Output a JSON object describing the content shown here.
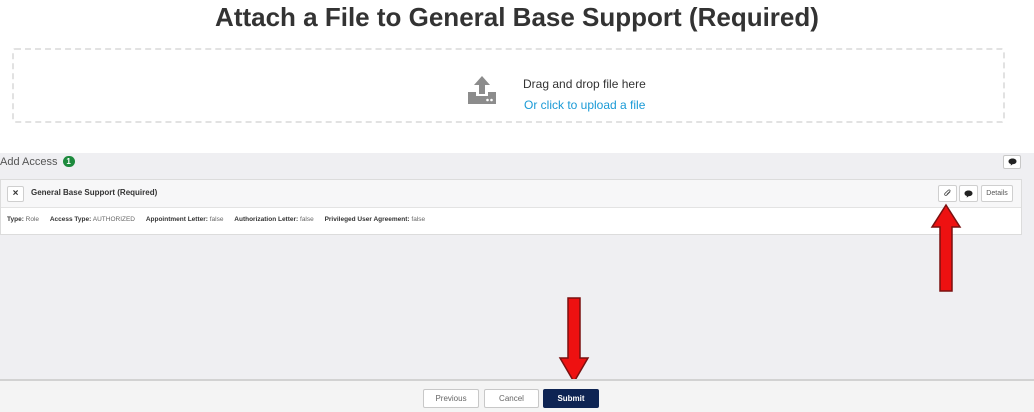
{
  "page": {
    "title": "Attach a File to General Base Support (Required)"
  },
  "upload": {
    "drag_text": "Drag and drop file here",
    "click_text": "Or click to upload a file",
    "icon": "upload-icon"
  },
  "access": {
    "title": "Add Access",
    "count": "1",
    "item": {
      "name": "General Base Support (Required)",
      "details_label": "Details",
      "meta": [
        {
          "key": "Type:",
          "value": "Role"
        },
        {
          "key": "Access Type:",
          "value": "AUTHORIZED"
        },
        {
          "key": "Appointment Letter:",
          "value": "false"
        },
        {
          "key": "Authorization Letter:",
          "value": "false"
        },
        {
          "key": "Privileged User Agreement:",
          "value": "false"
        }
      ]
    }
  },
  "footer": {
    "previous_label": "Previous",
    "cancel_label": "Cancel",
    "submit_label": "Submit"
  },
  "colors": {
    "accent_link": "#1a9ad6",
    "submit_bg": "#0e2453",
    "badge_green": "#1d8a3d",
    "annotation_arrow": "#ee1111"
  }
}
